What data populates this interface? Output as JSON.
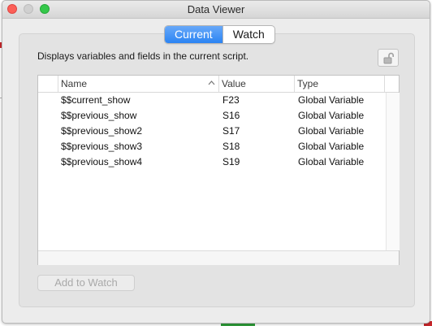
{
  "window": {
    "title": "Data Viewer"
  },
  "tabs": [
    {
      "label": "Current",
      "selected": true
    },
    {
      "label": "Watch",
      "selected": false
    }
  ],
  "description": "Displays variables and fields in the current script.",
  "table": {
    "columns": {
      "name": "Name",
      "value": "Value",
      "type": "Type"
    },
    "sort": {
      "column": "Name",
      "direction": "ascending"
    },
    "rows": [
      {
        "name": "$$current_show",
        "value": "F23",
        "type": "Global Variable"
      },
      {
        "name": "$$previous_show",
        "value": "S16",
        "type": "Global Variable"
      },
      {
        "name": "$$previous_show2",
        "value": "S17",
        "type": "Global Variable"
      },
      {
        "name": "$$previous_show3",
        "value": "S18",
        "type": "Global Variable"
      },
      {
        "name": "$$previous_show4",
        "value": "S19",
        "type": "Global Variable"
      }
    ]
  },
  "buttons": {
    "add_to_watch": "Add to Watch",
    "add_to_watch_enabled": false
  },
  "icons": {
    "lock": "unlocked-lock-icon",
    "sort": "sort-ascending-icon"
  },
  "colors": {
    "accent": "#2b84f3",
    "close": "#fc5f57",
    "zoom": "#34c84a"
  }
}
